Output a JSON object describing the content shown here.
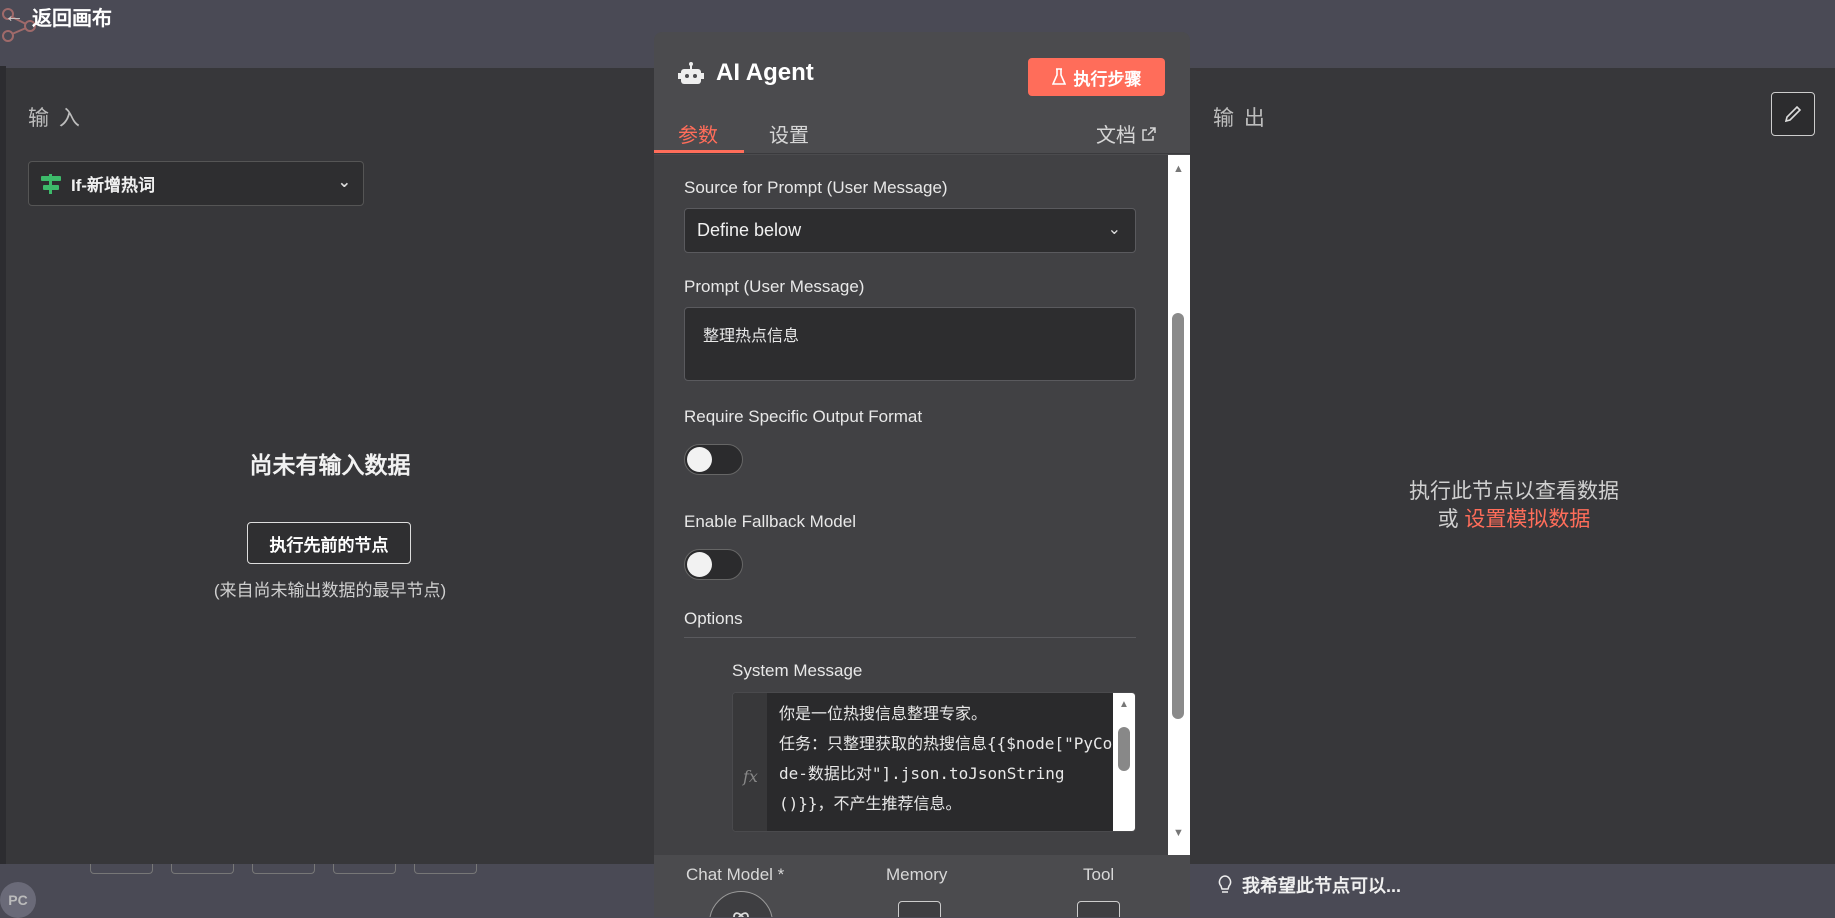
{
  "header": {
    "back_label": "返回画布"
  },
  "input_panel": {
    "title": "输 入",
    "node_select_value": "If-新增热词",
    "empty_title": "尚未有输入数据",
    "run_prev_button": "执行先前的节点",
    "hint": "(来自尚未输出数据的最早节点)"
  },
  "output_panel": {
    "title": "输 出",
    "message_line1": "执行此节点以查看数据",
    "message_or": "或",
    "mock_link": "设置模拟数据"
  },
  "modal": {
    "title": "AI Agent",
    "exec_button": "执行步骤",
    "tabs": [
      {
        "label": "参数",
        "active": true
      },
      {
        "label": "设置",
        "active": false
      }
    ],
    "docs_label": "文档",
    "fields": {
      "source_label": "Source for Prompt (User Message)",
      "source_value": "Define below",
      "prompt_label": "Prompt (User Message)",
      "prompt_value": "整理热点信息",
      "require_format_label": "Require Specific Output Format",
      "require_format_on": false,
      "fallback_label": "Enable Fallback Model",
      "fallback_on": false,
      "options_label": "Options",
      "system_message_label": "System Message",
      "system_message_value": "你是一位热搜信息整理专家。\n任务：只整理获取的热搜信息{{$node[\"PyCode-数据比对\"].json.toJsonString()}}，不产生推荐信息。",
      "fx_label": "fx"
    },
    "sub_nodes": [
      {
        "label": "Chat Model *"
      },
      {
        "label": "Memory"
      },
      {
        "label": "Tool"
      }
    ]
  },
  "footer": {
    "avatar_initials": "PC",
    "wish_label": "我希望此节点可以..."
  },
  "colors": {
    "accent": "#ff6d5a",
    "panel_bg": "#37373a",
    "modal_bg": "#4b4b4e",
    "toggle_knob": "#f2f2f2"
  },
  "icons": [
    "arrow-left-icon",
    "node-graph-icon",
    "signpost-icon",
    "chevron-down-icon",
    "robot-icon",
    "flask-icon",
    "external-link-icon",
    "pencil-icon",
    "openai-icon",
    "plus-icon",
    "lightbulb-icon"
  ]
}
